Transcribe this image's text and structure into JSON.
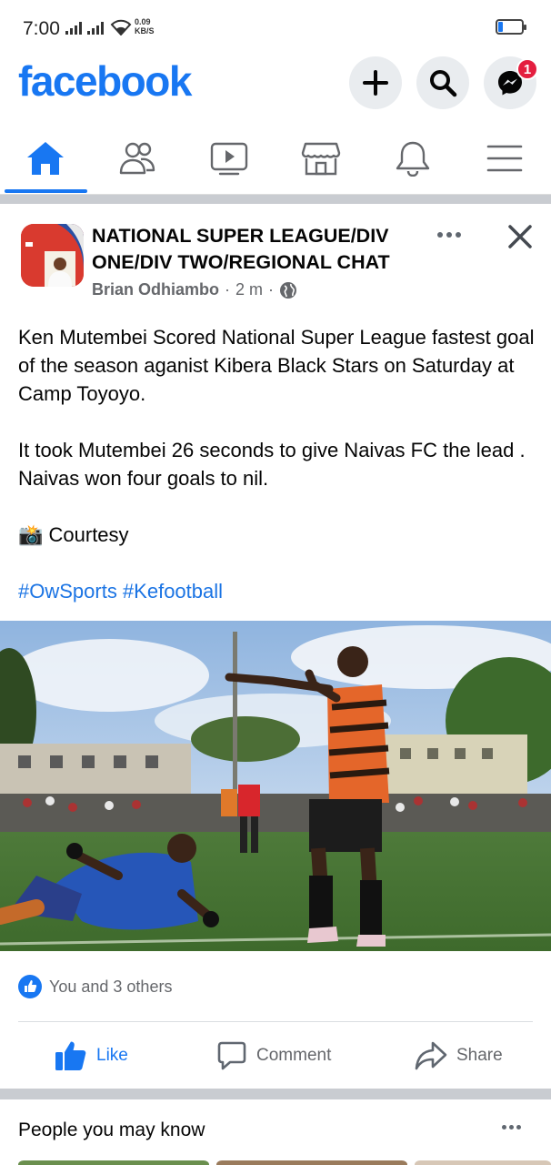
{
  "status_bar": {
    "time": "7:00",
    "net_speed_value": "0.09",
    "net_speed_unit": "KB/S",
    "battery_level": 0.18
  },
  "header": {
    "logo": "facebook",
    "create_icon": "plus-icon",
    "search_icon": "search-icon",
    "messenger_icon": "messenger-icon",
    "messenger_badge": "1"
  },
  "nav_tabs": [
    {
      "name": "home",
      "icon": "home-icon",
      "active": true
    },
    {
      "name": "friends",
      "icon": "friends-icon",
      "active": false
    },
    {
      "name": "watch",
      "icon": "video-icon",
      "active": false
    },
    {
      "name": "marketplace",
      "icon": "marketplace-icon",
      "active": false
    },
    {
      "name": "notifications",
      "icon": "bell-icon",
      "active": false
    },
    {
      "name": "menu",
      "icon": "hamburger-icon",
      "active": false
    }
  ],
  "post": {
    "group_name": "NATIONAL SUPER LEAGUE/DIV ONE/DIV TWO/REGIONAL CHAT",
    "author": "Brian Odhiambo",
    "time_separator": "·",
    "time": "2 m",
    "privacy_icon": "globe-icon",
    "paragraphs": [
      "Ken Mutembei Scored National Super League fastest goal of the season aganist Kibera Black Stars on Saturday at Camp Toyoyo.",
      "It took Mutembei 26 seconds to give Naivas FC the lead . Naivas won four goals to nil.",
      "📸 Courtesy"
    ],
    "hashtags": "#OwSports #Kefootball",
    "reactions_text": "You and 3 others",
    "actions": {
      "like": "Like",
      "comment": "Comment",
      "share": "Share"
    }
  },
  "people_you_may_know": {
    "title": "People you may know"
  },
  "colors": {
    "brand_blue": "#1877f2",
    "text_secondary": "#65676b",
    "badge_red": "#e41e3f"
  }
}
